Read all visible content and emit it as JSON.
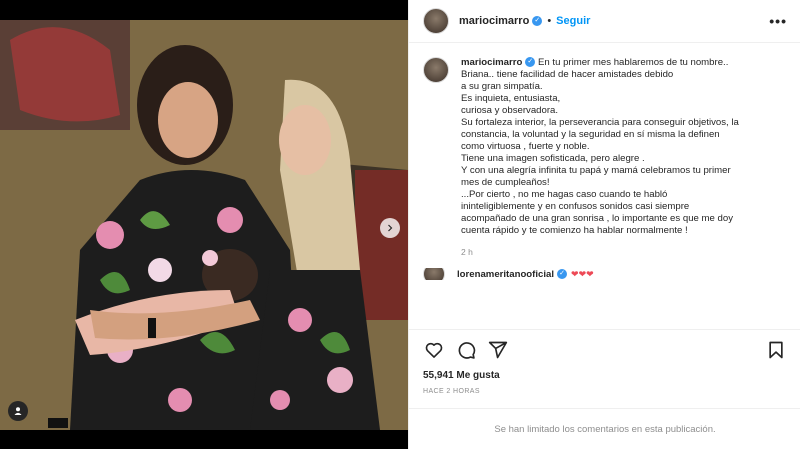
{
  "post": {
    "username": "mariocimarro",
    "follow_label": "Seguir",
    "dot": "•",
    "more_label": "•••"
  },
  "caption": {
    "username": "mariocimarro",
    "text": "En tu primer mes hablaremos de tu nombre..\nBriana.. tiene facilidad de hacer amistades debido\na su gran simpatía.\nEs inquieta, entusiasta,\ncuriosa y observadora.\nSu fortaleza interior, la perseverancia para conseguir objetivos, la\nconstancia, la voluntad y la seguridad en sí misma la definen\ncomo virtuosa , fuerte y noble.\nTiene una imagen sofisticada, pero alegre .\nY con una alegría infinita tu papá y mamá celebramos tu primer\nmes de cumpleaños!\n...Por cierto , no me hagas caso cuando te habló\nininteligiblemente y en confusos sonidos casi siempre\nacompañado de una gran sonrisa , lo importante es que me doy\ncuenta rápido y te comienzo ha hablar normalmente !",
    "time": "2 h"
  },
  "comment": {
    "username": "lorenameritanooficial",
    "text": "❤❤❤"
  },
  "stats": {
    "likes": "55,941 Me gusta",
    "time_ago": "HACE 2 HORAS"
  },
  "footer": {
    "limited_text": "Se han limitado los comentarios en esta publicación."
  },
  "icons": [
    "heart-icon",
    "comment-icon",
    "share-icon",
    "bookmark-icon",
    "chevron-right-icon",
    "user-tag-icon",
    "more-icon",
    "verified-icon"
  ],
  "colors": {
    "accent": "#0095f6",
    "verified": "#3897f0",
    "heart": "#ed4956",
    "muted": "#8e8e8e"
  }
}
